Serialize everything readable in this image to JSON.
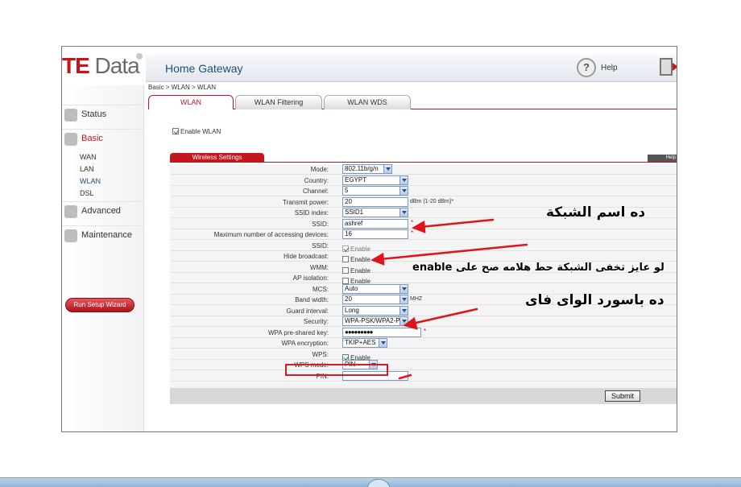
{
  "logo": {
    "brand_prefix": "TE",
    "brand_suffix": " Data"
  },
  "header": {
    "title": "Home Gateway",
    "help_label": "Help"
  },
  "breadcrumb": "Basic > WLAN > WLAN",
  "tabs": [
    {
      "label": "WLAN",
      "active": true
    },
    {
      "label": "WLAN Filtering",
      "active": false
    },
    {
      "label": "WLAN WDS",
      "active": false
    }
  ],
  "sidebar": {
    "items": [
      {
        "label": "Status",
        "icon": "status-icon"
      },
      {
        "label": "Basic",
        "icon": "basic-icon",
        "active": true
      },
      {
        "label": "Advanced",
        "icon": "advanced-icon"
      },
      {
        "label": "Maintenance",
        "icon": "maintenance-icon"
      }
    ],
    "sub_items": [
      "WAN",
      "LAN",
      "WLAN",
      "DSL"
    ],
    "wizard_label": "Run Setup Wizard"
  },
  "enable_wlan_label": "Enable WLAN",
  "section": {
    "title": "Wireless Settings",
    "help": "Help"
  },
  "form": {
    "mode": {
      "label": "Mode:",
      "value": "802.11b/g/n"
    },
    "country": {
      "label": "Country:",
      "value": "EGYPT"
    },
    "channel": {
      "label": "Channel:",
      "value": "5"
    },
    "transmit_power": {
      "label": "Transmit power:",
      "value": "20",
      "suffix": "dBm (1-20 dBm)*"
    },
    "ssid_index": {
      "label": "SSID index:",
      "value": "SSID1"
    },
    "ssid": {
      "label": "SSID:",
      "value": "ashref",
      "star": "*"
    },
    "max_devices": {
      "label": "Maximum number of accessing devices:",
      "value": "16",
      "star": "*"
    },
    "ssid_enable": {
      "label": "SSID:",
      "check_label": "Enable"
    },
    "hide_broadcast": {
      "label": "Hide broadcast:",
      "check_label": "Enable"
    },
    "wmm": {
      "label": "WMM:",
      "check_label": "Enable"
    },
    "ap_isolation": {
      "label": "AP isolation:",
      "check_label": "Enable"
    },
    "mcs": {
      "label": "MCS:",
      "value": "Auto"
    },
    "bandwidth": {
      "label": "Band width:",
      "value": "20",
      "suffix": "MHZ"
    },
    "guard_interval": {
      "label": "Guard interval:",
      "value": "Long"
    },
    "security": {
      "label": "Security:",
      "value": "WPA-PSK/WPA2-P"
    },
    "wpa_key": {
      "label": "WPA pre-shared key:",
      "value": "●●●●●●●●●",
      "star": "*"
    },
    "wpa_encryption": {
      "label": "WPA encryption:",
      "value": "TKIP+AES"
    },
    "wps": {
      "label": "WPS:",
      "check_label": "Enable"
    },
    "wps_mode": {
      "label": "WPS mode:",
      "value": "PIN"
    },
    "pin": {
      "label": "PIN:",
      "value": ""
    }
  },
  "submit_label": "Submit",
  "annotations": {
    "ssid_note": "ده اسم الشبكة",
    "hide_note": "enable لو عايز تخفى الشبكة حط هلامه صح على",
    "password_note": "ده باسورد الواى فاى"
  },
  "colors": {
    "brand_red": "#c4161c",
    "arrow_red": "#e0141c",
    "title_blue": "#1f4e79"
  }
}
